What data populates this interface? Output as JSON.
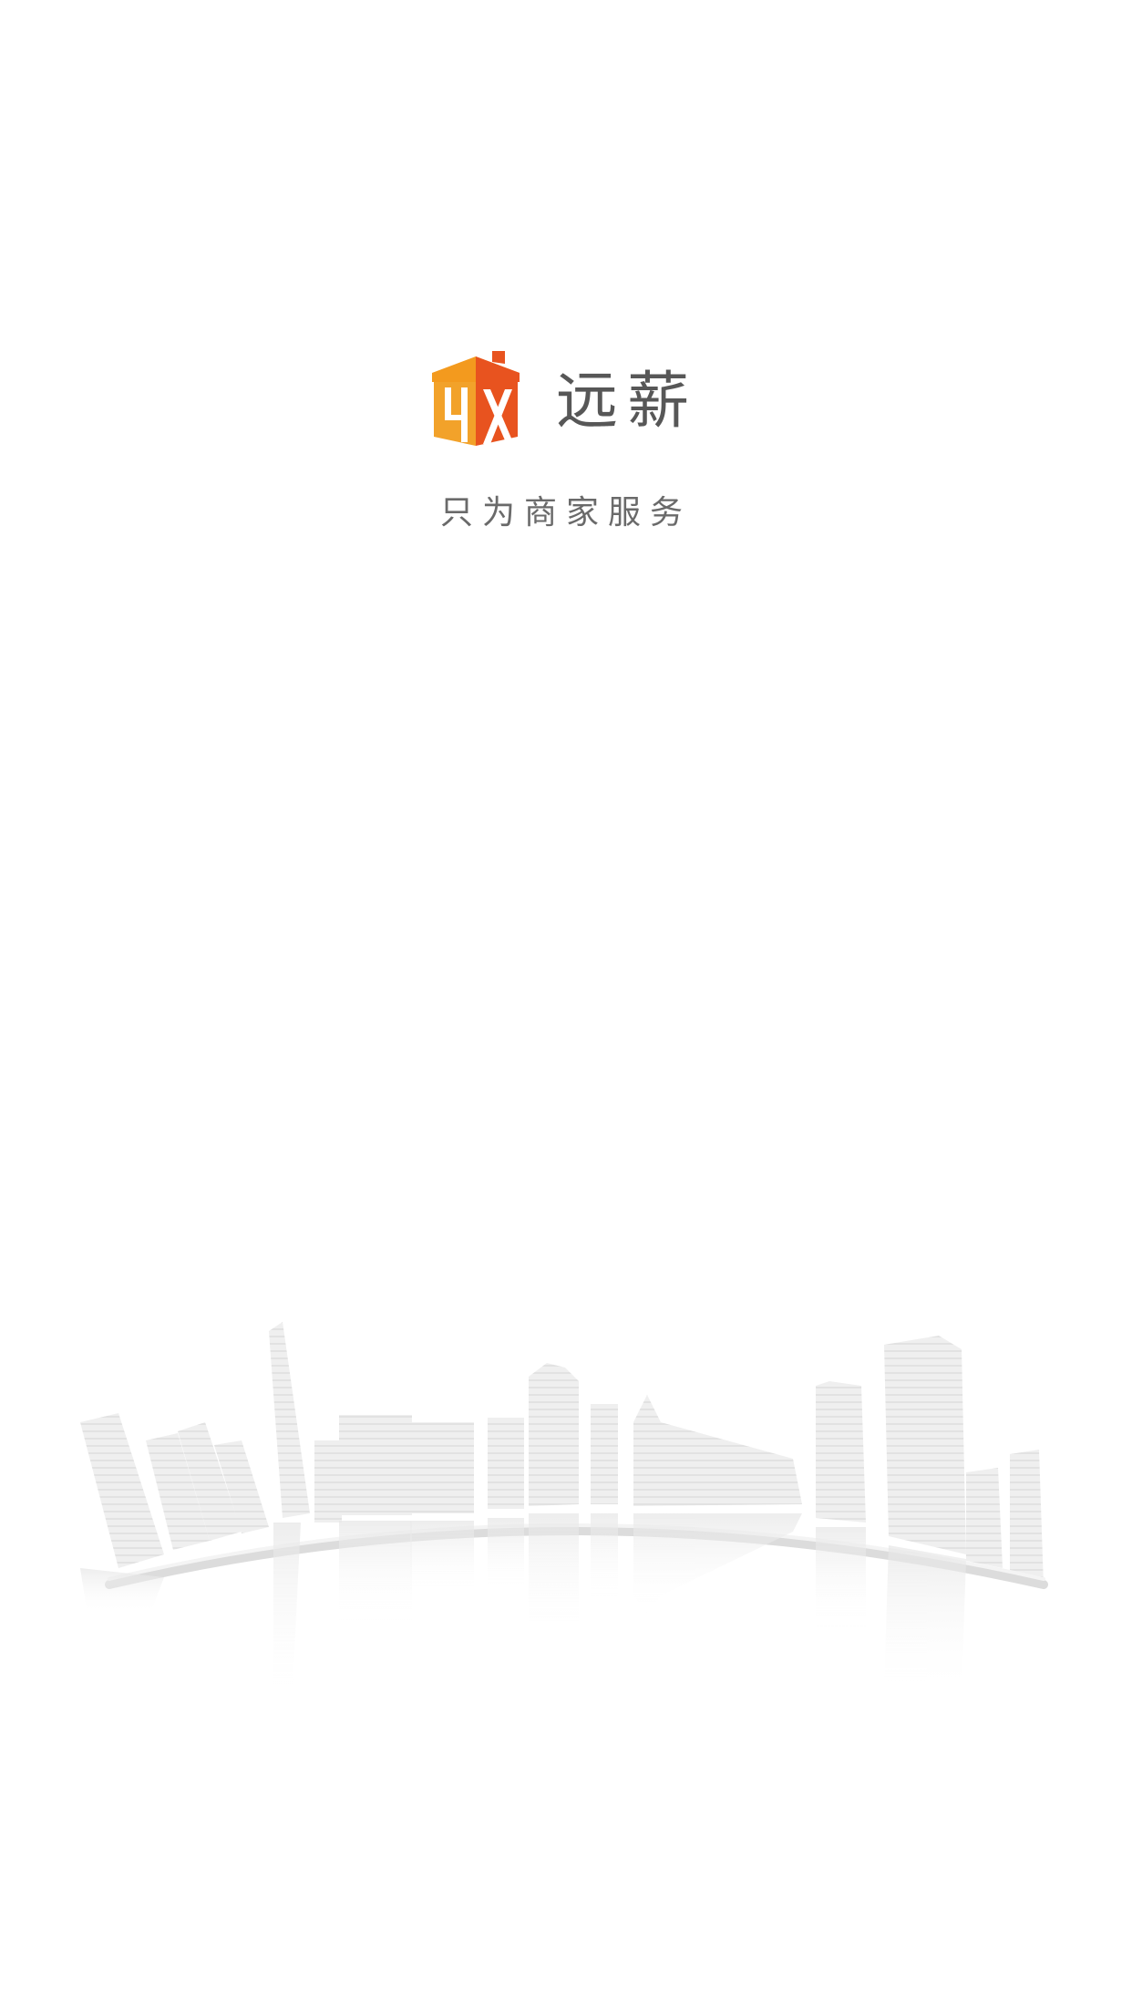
{
  "brand": {
    "name": "远薪",
    "slogan": "只为商家服务",
    "logo_icon": "store-logo-icon",
    "colors": {
      "logo_orange": "#F39A1E",
      "logo_red": "#E8531F",
      "text": "#575757"
    }
  },
  "background": {
    "illustration": "city-skyline-illustration",
    "color": "#ffffff"
  }
}
